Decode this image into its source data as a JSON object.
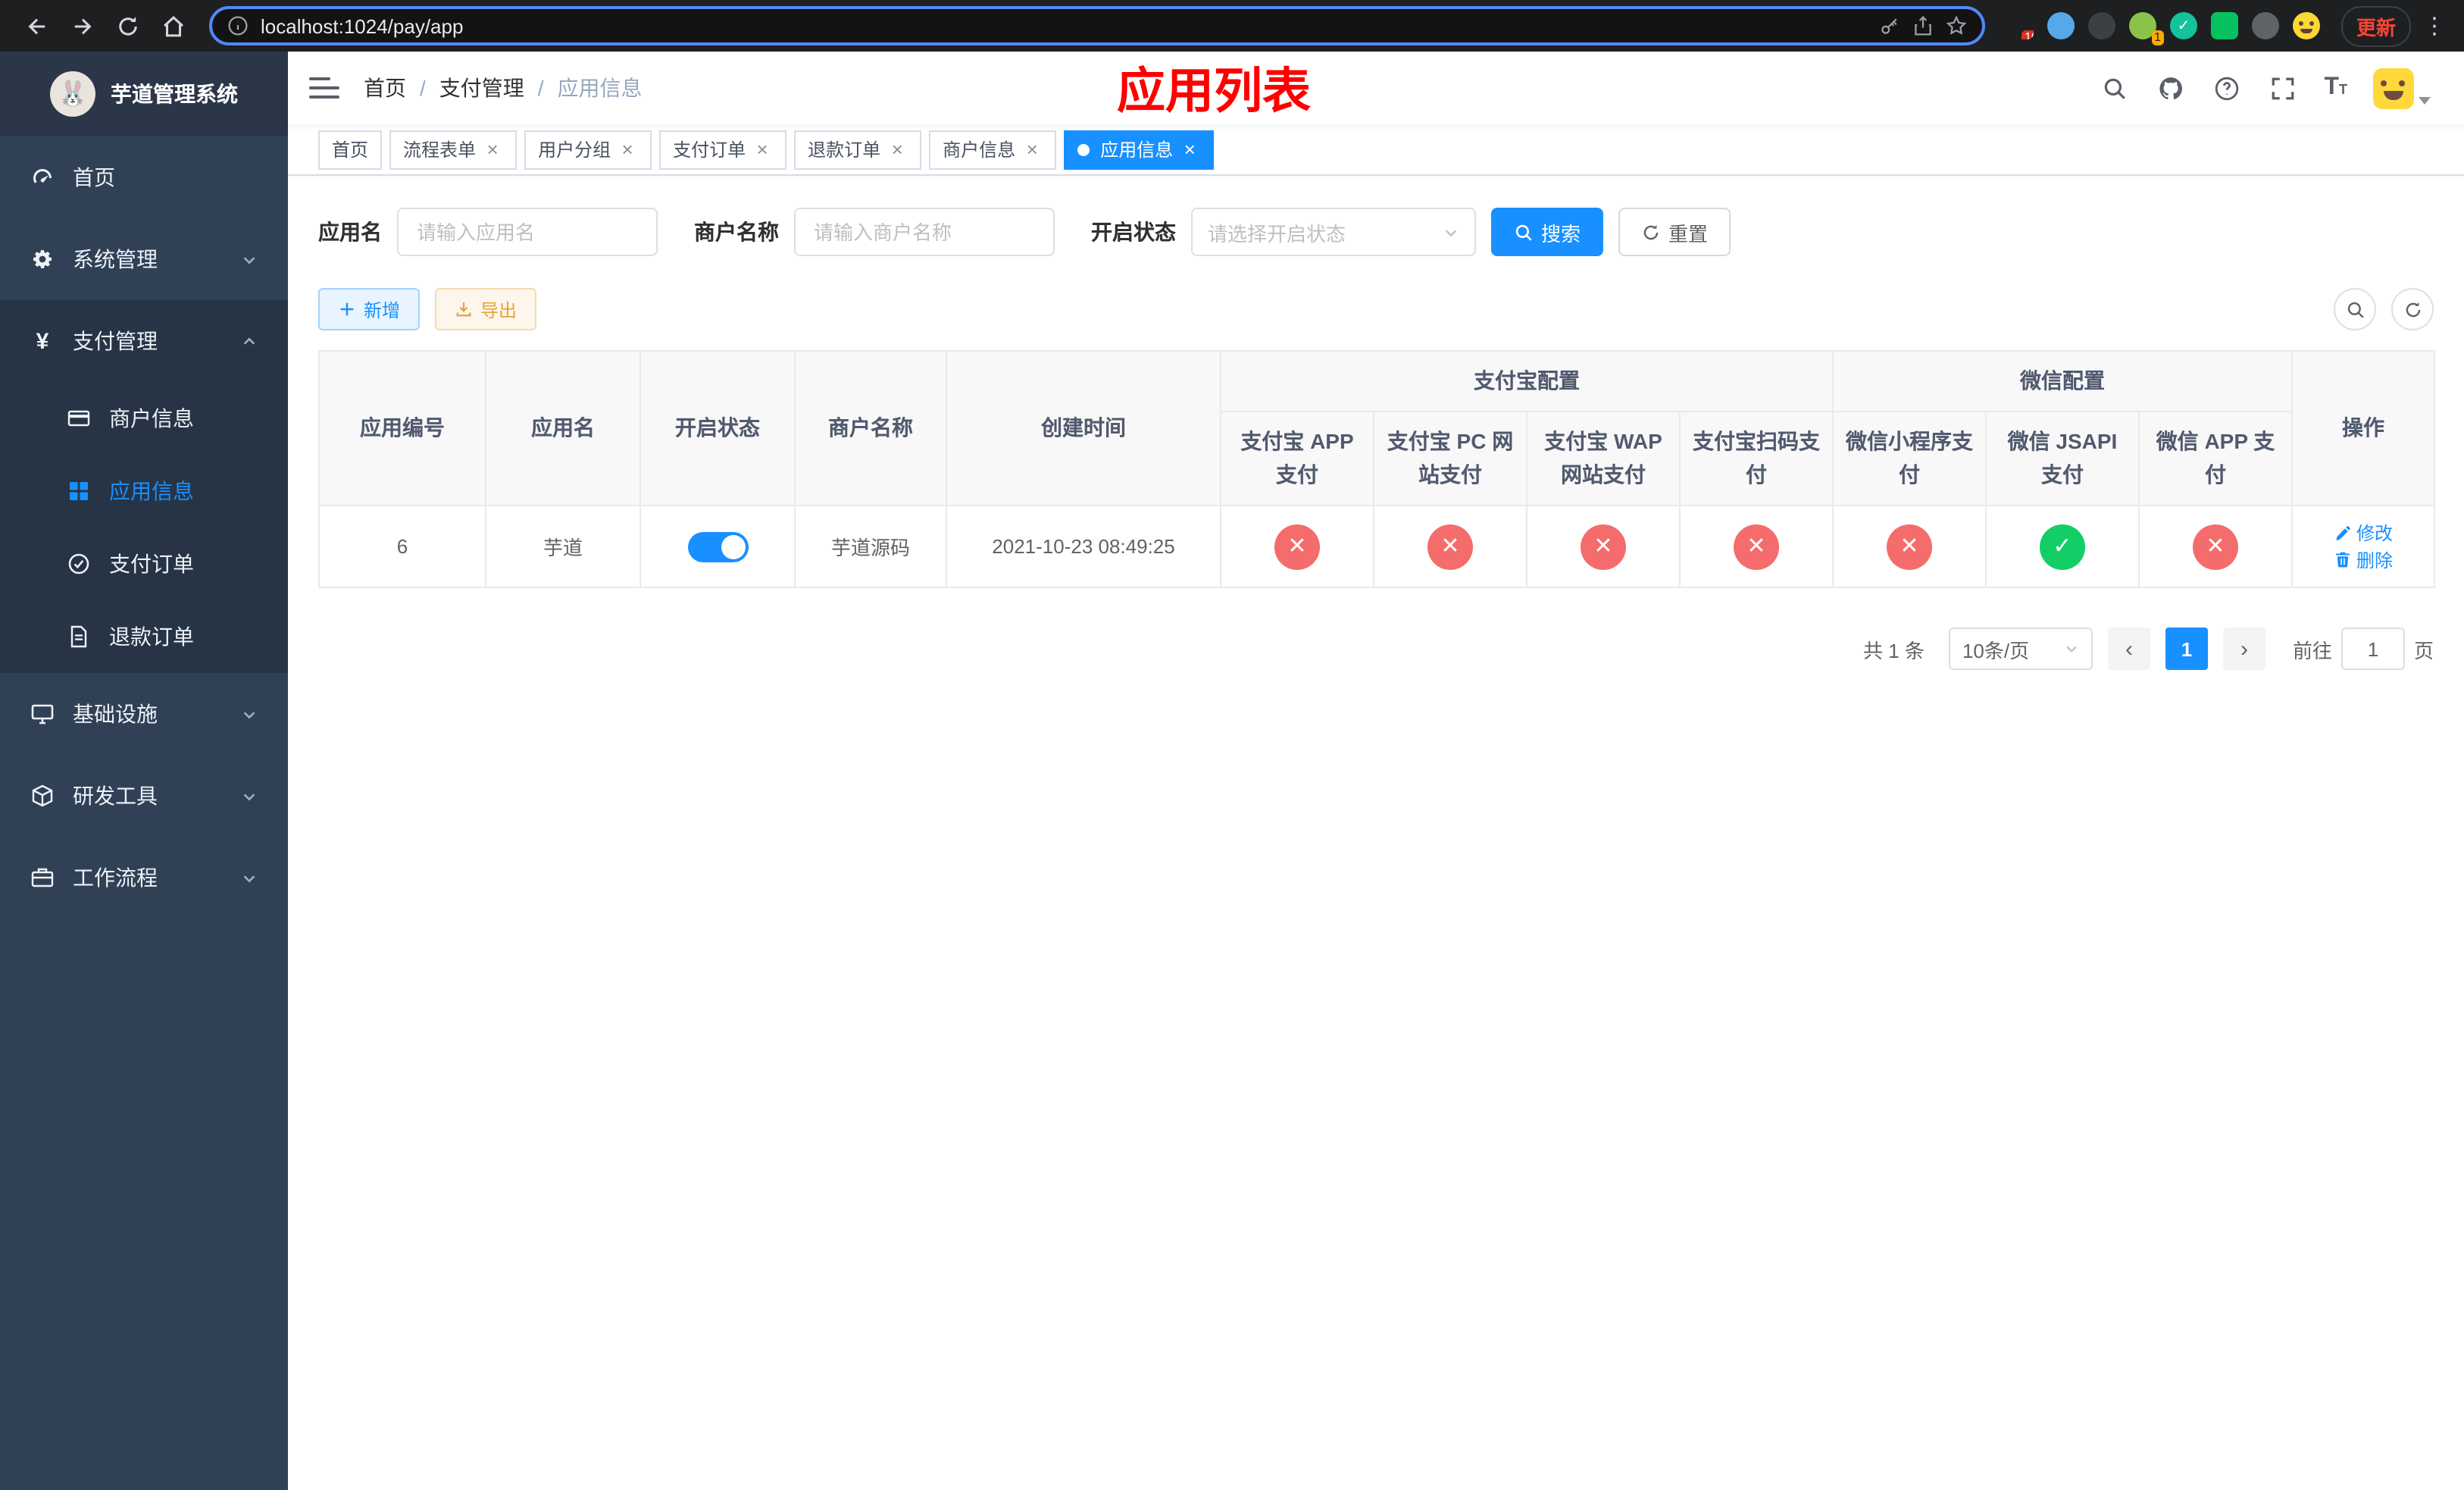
{
  "colors": {
    "primary": "#1890ff",
    "danger": "#f56c6c",
    "success": "#13ce66",
    "title_red": "#ff0000"
  },
  "browser": {
    "url": "localhost:1024/pay/app",
    "update_label": "更新",
    "ext_badge_mosaic": "10",
    "ext_badge_avatar": "1"
  },
  "sidebar": {
    "title": "芋道管理系统",
    "home": "首页",
    "system": "系统管理",
    "pay": "支付管理",
    "merchant": "商户信息",
    "app_info": "应用信息",
    "pay_order": "支付订单",
    "refund_order": "退款订单",
    "infra": "基础设施",
    "dev_tools": "研发工具",
    "workflow": "工作流程"
  },
  "navbar": {
    "breadcrumb": [
      "首页",
      "支付管理",
      "应用信息"
    ],
    "page_title": "应用列表"
  },
  "tabs": [
    {
      "label": "首页",
      "closable": false,
      "active": false
    },
    {
      "label": "流程表单",
      "closable": true,
      "active": false
    },
    {
      "label": "用户分组",
      "closable": true,
      "active": false
    },
    {
      "label": "支付订单",
      "closable": true,
      "active": false
    },
    {
      "label": "退款订单",
      "closable": true,
      "active": false
    },
    {
      "label": "商户信息",
      "closable": true,
      "active": false
    },
    {
      "label": "应用信息",
      "closable": true,
      "active": true
    }
  ],
  "filters": {
    "app_name_label": "应用名",
    "app_name_placeholder": "请输入应用名",
    "merchant_label": "商户名称",
    "merchant_placeholder": "请输入商户名称",
    "status_label": "开启状态",
    "status_placeholder": "请选择开启状态",
    "search_label": "搜索",
    "reset_label": "重置"
  },
  "toolbar": {
    "add_label": "新增",
    "export_label": "导出"
  },
  "table": {
    "groups": {
      "alipay": "支付宝配置",
      "wechat": "微信配置"
    },
    "columns": [
      "应用编号",
      "应用名",
      "开启状态",
      "商户名称",
      "创建时间",
      "支付宝 APP 支付",
      "支付宝 PC 网站支付",
      "支付宝 WAP 网站支付",
      "支付宝扫码支付",
      "微信小程序支付",
      "微信 JSAPI 支付",
      "微信 APP 支付",
      "操作"
    ],
    "rows": [
      {
        "id": "6",
        "name": "芋道",
        "enabled": true,
        "merchant": "芋道源码",
        "created": "2021-10-23 08:49:25",
        "configs": [
          "no",
          "no",
          "no",
          "no",
          "no",
          "yes",
          "no"
        ],
        "edit_label": "修改",
        "delete_label": "删除"
      }
    ]
  },
  "pagination": {
    "total": "共 1 条",
    "page_size": "10条/页",
    "page": "1",
    "goto_label": "前往",
    "goto_value": "1",
    "unit_label": "页"
  }
}
